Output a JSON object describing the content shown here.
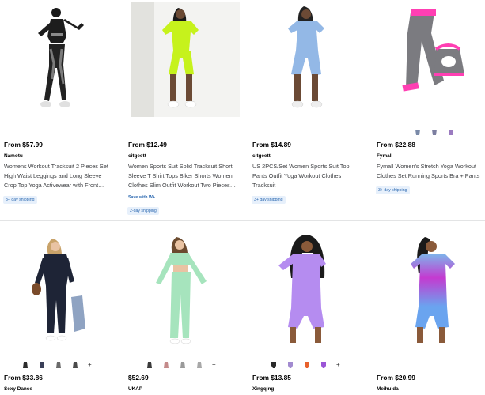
{
  "products": [
    {
      "price": "From $57.99",
      "seller": "Namotu",
      "title": "Womens Workout Tracksuit 2 Pieces Set High Waist Leggings and Long Sleeve Crop Top Yoga Activewear with Front…",
      "shipping": "3+ day shipping"
    },
    {
      "price": "From $12.49",
      "seller": "citgeett",
      "title": "Women Sports Suit Solid Tracksuit Short Sleeve T Shirt Tops Biker Shorts Women Clothes Slim Outfit Workout Two Pieces…",
      "promo": "Save with W+",
      "shipping": "2-day shipping"
    },
    {
      "price": "From $14.89",
      "seller": "citgeett",
      "title": "US 2PCS/Set Women Sports Suit Top Pants Outfit Yoga Workout Clothes Tracksuit",
      "shipping": "3+ day shipping"
    },
    {
      "price": "From $22.88",
      "seller": "Fymall",
      "title": "Fymall Women's Stretch Yoga Workout Clothes Set Running Sports Bra + Pants",
      "shipping": "3+ day shipping"
    },
    {
      "price": "From $33.86",
      "seller": "Sexy Dance",
      "more_label": "+"
    },
    {
      "price": "$52.69",
      "seller": "UKAP",
      "more_label": "+"
    },
    {
      "price": "From $13.85",
      "seller": "Xingqing",
      "more_label": "+"
    },
    {
      "price": "From $20.99",
      "seller": "Meihuida"
    }
  ],
  "colors": {
    "link_blue": "#2e6ab1",
    "shipping_bg": "#e7f0fb",
    "neon_green": "#c6f21c",
    "light_blue": "#93b8e6",
    "hot_pink": "#ff3fb3",
    "mint": "#a6e4bd",
    "lavender": "#b58cf0",
    "navy": "#1e2436",
    "gradient_purple": "#c43ad0"
  }
}
